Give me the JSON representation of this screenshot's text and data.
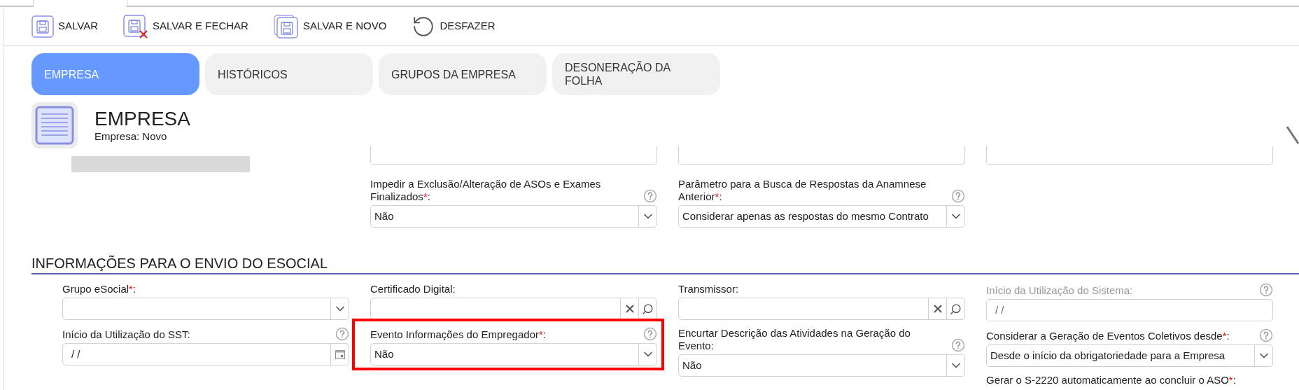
{
  "toolbar": [
    {
      "label": "SALVAR",
      "kind": "save"
    },
    {
      "label": "SALVAR E FECHAR",
      "kind": "save-close"
    },
    {
      "label": "SALVAR E NOVO",
      "kind": "save-new"
    },
    {
      "label": "DESFAZER",
      "kind": "undo"
    }
  ],
  "tabs": [
    {
      "label": "EMPRESA",
      "selected": true
    },
    {
      "label": "HISTÓRICOS",
      "selected": false
    },
    {
      "label": "GRUPOS DA EMPRESA",
      "selected": false
    },
    {
      "label": "DESONERAÇÃO DA FOLHA",
      "selected": false
    }
  ],
  "header": {
    "title": "EMPRESA",
    "subtitle": "Empresa: Novo"
  },
  "upper_fields": [
    {
      "label": "Impedir a Exclusão/Alteração de ASOs e Exames Finalizados",
      "mark": "*",
      "tail": ":",
      "help": true,
      "kind": "select",
      "value": "Não"
    },
    {
      "label": "Parâmetro para a Busca de Respostas da Anamnese Anterior",
      "mark": "*",
      "tail": ":",
      "help": true,
      "kind": "select",
      "value": "Considerar apenas as respostas do mesmo Contrato"
    }
  ],
  "section": {
    "title": "INFORMAÇÕES PARA O ENVIO DO ESOCIAL",
    "columns": [
      [
        {
          "label": "Grupo eSocial",
          "mark": "*",
          "tail": ":",
          "help": false,
          "kind": "select"
        },
        {
          "label": "Início da Utilização do SST",
          "tail": ":",
          "help": true,
          "kind": "date",
          "value": "/ /"
        }
      ],
      [
        {
          "label": "Certificado Digital",
          "tail": ":",
          "help": false,
          "kind": "lookup"
        },
        {
          "label": "Evento Informações do Empregador",
          "mark": "*",
          "tail": ":",
          "help": true,
          "kind": "select",
          "value": "Não",
          "highlighted": true
        }
      ],
      [
        {
          "label": "Transmissor",
          "tail": ":",
          "help": false,
          "kind": "lookup"
        },
        {
          "label": "Encurtar Descrição das Atividades na Geração do Evento",
          "tail": ":",
          "help": true,
          "kind": "select",
          "value": "Não"
        }
      ],
      [
        {
          "label": "Início da Utilização do Sistema",
          "tail": ":",
          "help": true,
          "kind": "text",
          "value": "/ /",
          "disabled": true
        },
        {
          "label": "Considerar a Geração de Eventos Coletivos desde",
          "mark": "*",
          "tail": ":",
          "help": true,
          "kind": "select",
          "value": "Desde o início da obrigatoriedade para a Empresa"
        },
        {
          "label": "Gerar o S-2220 automaticamente ao concluir o ASO",
          "mark": "*",
          "tail": ":",
          "help": false
        }
      ]
    ]
  }
}
